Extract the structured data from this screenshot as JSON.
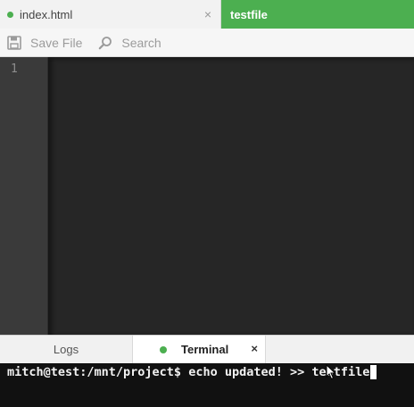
{
  "tabs": [
    {
      "label": "index.html",
      "close": "×"
    },
    {
      "label": "testfile"
    }
  ],
  "toolbar": {
    "save_label": "Save File",
    "search_label": "Search"
  },
  "editor": {
    "line_numbers": [
      "1"
    ]
  },
  "panel": {
    "logs_label": "Logs",
    "terminal_label": "Terminal",
    "terminal_close": "×"
  },
  "terminal": {
    "prompt": "mitch@test:/mnt/project$",
    "command": " echo updated! >> testfile"
  },
  "colors": {
    "accent": "#4caf50",
    "editor_bg": "#262626",
    "gutter_bg": "#3a3a3a",
    "terminal_bg": "#111111"
  }
}
